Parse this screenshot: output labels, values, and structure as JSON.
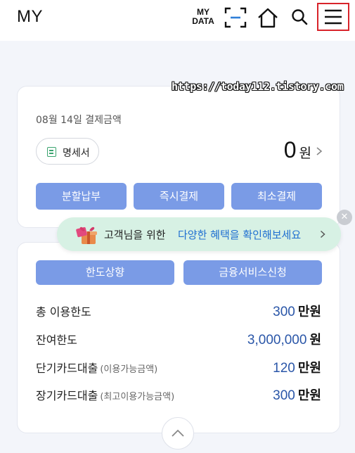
{
  "header": {
    "title": "MY",
    "mydata_line1": "MY",
    "mydata_line2": "DATA",
    "icons": [
      "scan-icon",
      "home-icon",
      "search-icon",
      "menu-icon"
    ]
  },
  "watermark": "https://today112.tistory.com",
  "payment": {
    "date_label": "08월 14일 결제금액",
    "statement_label": "명세서",
    "amount": "0",
    "unit": "원",
    "buttons": [
      "분할납부",
      "즉시결제",
      "최소결제"
    ]
  },
  "promo": {
    "text_prefix": "고객님을 위한",
    "text_link": "다양한 혜택을 확인해보세요",
    "close": "✕"
  },
  "limits": {
    "buttons": [
      "한도상향",
      "금융서비스신청"
    ],
    "rows": [
      {
        "label": "총 이용한도",
        "sub": "",
        "value": "300",
        "unit": "만원"
      },
      {
        "label": "잔여한도",
        "sub": "",
        "value": "3,000,000",
        "unit": "원"
      },
      {
        "label": "단기카드대출",
        "sub": "(이용가능금액)",
        "value": "120",
        "unit": "만원"
      },
      {
        "label": "장기카드대출",
        "sub": "(최고이용가능금액)",
        "value": "300",
        "unit": "만원"
      }
    ]
  },
  "colors": {
    "accent_button": "#7a9be6",
    "promo_bg": "#d7f1e4",
    "promo_link": "#1f6fd1",
    "value_blue": "#2a56a8",
    "highlight_box": "#d8232a"
  }
}
